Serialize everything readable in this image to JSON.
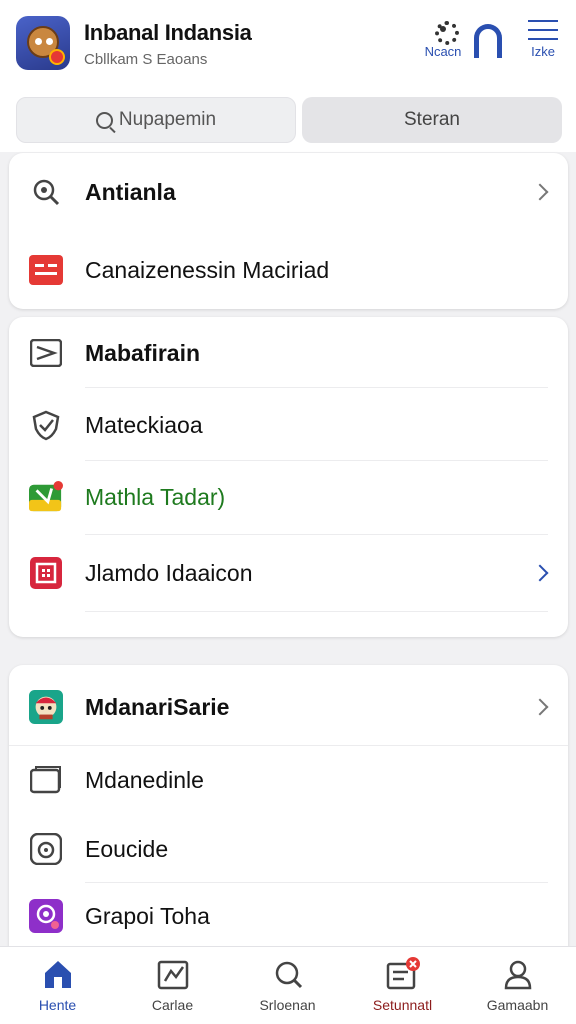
{
  "header": {
    "title": "Inbanal Indansia",
    "subtitle": "Cbllkam S Eaoans",
    "actions": [
      {
        "label": "Ncacn",
        "icon": "gear-icon"
      },
      {
        "label": "",
        "icon": "arch-icon"
      },
      {
        "label": "Izke",
        "icon": "menu-icon"
      }
    ]
  },
  "search": {
    "placeholder": "Nupapemin"
  },
  "stream_button": {
    "label": "Steran"
  },
  "section1": {
    "items": [
      {
        "label": "Antianla",
        "icon": "magnifier-icon"
      },
      {
        "label": "Canaizenessin Maciriad",
        "icon": "red-card-icon"
      }
    ]
  },
  "section2": {
    "items": [
      {
        "label": "Mabafirain",
        "icon": "flag-icon"
      },
      {
        "label": "Mateckiaoa",
        "icon": "shield-check-icon"
      },
      {
        "label": "Mathla Tadar)",
        "icon": "green-game-icon"
      },
      {
        "label": "Jlamdo Idaaicon",
        "icon": "red-grid-icon"
      }
    ]
  },
  "section3": {
    "items": [
      {
        "label": "MdanariSarie",
        "icon": "character-icon"
      },
      {
        "label": "Mdanedinle",
        "icon": "folder-icon"
      },
      {
        "label": "Eoucide",
        "icon": "camera-icon"
      },
      {
        "label": "Grapoi Toha",
        "icon": "purple-app-icon"
      }
    ]
  },
  "nav": [
    {
      "label": "Hente",
      "icon": "home-icon"
    },
    {
      "label": "Carlae",
      "icon": "calendar-icon"
    },
    {
      "label": "Srloenan",
      "icon": "search-icon"
    },
    {
      "label": "Setunnatl",
      "icon": "list-icon"
    },
    {
      "label": "Gamaabn",
      "icon": "profile-icon"
    }
  ],
  "colors": {
    "accent": "#2a4fb0",
    "red": "#e53935",
    "green": "#1e7a1e"
  }
}
